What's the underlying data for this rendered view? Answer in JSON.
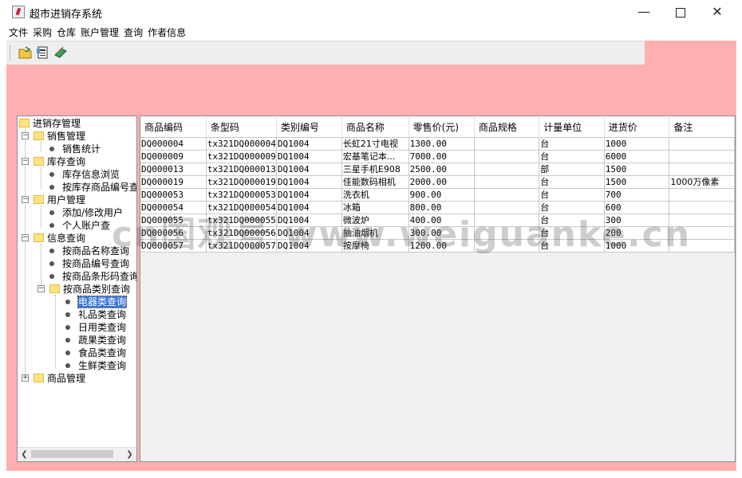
{
  "window": {
    "title": "超市进销存系统"
  },
  "menubar": {
    "items": [
      "文件",
      "采购",
      "仓库",
      "账户管理",
      "查询",
      "作者信息"
    ]
  },
  "toolbar": {
    "buttons": [
      {
        "icon": "open-folder-icon"
      },
      {
        "icon": "document-icon"
      },
      {
        "icon": "books-icon"
      }
    ]
  },
  "tree": {
    "root": "进销存管理",
    "sales": {
      "label": "销售管理",
      "children": [
        "销售统计"
      ]
    },
    "stock": {
      "label": "库存查询",
      "children": [
        "库存信息浏览",
        "按库存商品编号查"
      ]
    },
    "user": {
      "label": "用户管理",
      "children": [
        "添加/修改用户",
        "个人账户查"
      ]
    },
    "info": {
      "label": "信息查询",
      "children": [
        "按商品名称查询",
        "按商品编号查询",
        "按商品条形码查询"
      ],
      "category": {
        "label": "按商品类别查询",
        "children": [
          "电器类查询",
          "礼品类查询",
          "日用类查询",
          "蔬果类查询",
          "食品类查询",
          "生鲜类查询"
        ]
      }
    },
    "goods": {
      "label": "商品管理"
    }
  },
  "table": {
    "columns": [
      "商品编码",
      "条型码",
      "类别编号",
      "商品名称",
      "零售价(元)",
      "商品规格",
      "计量单位",
      "进货价",
      "备注"
    ],
    "rows": [
      [
        "DQ000004",
        "tx321DQ000004",
        "DQ1004",
        "长虹21寸电视",
        "1300.00",
        "",
        "台",
        "1000",
        ""
      ],
      [
        "DQ000009",
        "tx321DQ000009",
        "DQ1004",
        "宏基笔记本...",
        "7000.00",
        "",
        "台",
        "6000",
        ""
      ],
      [
        "DQ000013",
        "tx321DQ000013",
        "DQ1004",
        "三星手机E908",
        "2500.00",
        "",
        "部",
        "1500",
        ""
      ],
      [
        "DQ000019",
        "tx321DQ000019",
        "DQ1004",
        "佳能数码相机",
        "2000.00",
        "",
        "台",
        "1500",
        "1000万像素"
      ],
      [
        "DQ000053",
        "tx321DQ000053",
        "DQ1004",
        "洗衣机",
        "900.00",
        "",
        "台",
        "700",
        ""
      ],
      [
        "DQ000054",
        "tx321DQ000054",
        "DQ1004",
        "冰箱",
        "800.00",
        "",
        "台",
        "600",
        ""
      ],
      [
        "DQ000055",
        "tx321DQ000055",
        "DQ1004",
        "微波炉",
        "400.00",
        "",
        "台",
        "300",
        ""
      ],
      [
        "DQ000056",
        "tx321DQ000056",
        "DQ1004",
        "抽油烟机",
        "300.00",
        "",
        "台",
        "200",
        ""
      ],
      [
        "DQ000057",
        "tx321DQ000057",
        "DQ1004",
        "按摩椅",
        "1200.00",
        "",
        "台",
        "1000",
        ""
      ]
    ]
  },
  "watermark": "cn国观号 www.weiguanke.cn"
}
